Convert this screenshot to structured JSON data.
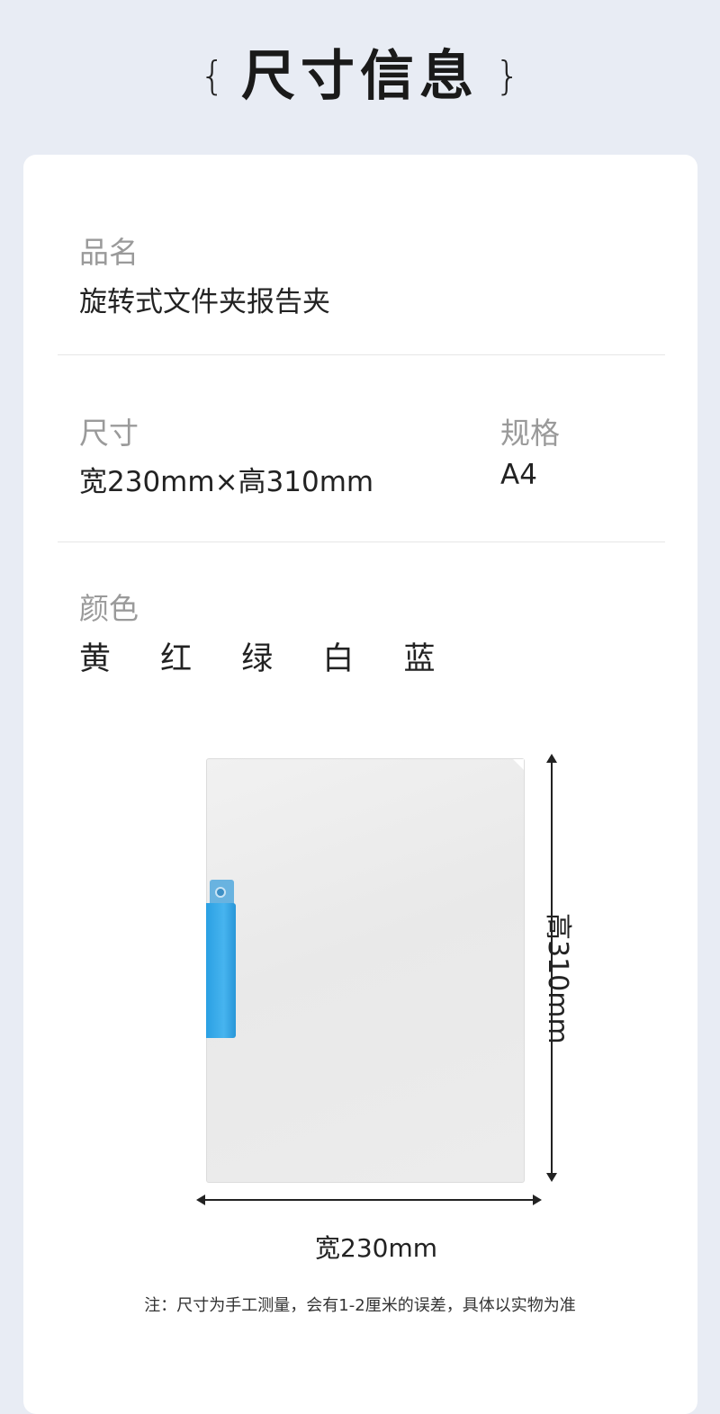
{
  "header": {
    "brace_left": "{",
    "title": "尺寸信息",
    "brace_right": "}"
  },
  "product": {
    "label": "品名",
    "value": "旋转式文件夹报告夹"
  },
  "size": {
    "label": "尺寸",
    "value": "宽230mm×高310mm"
  },
  "spec": {
    "label": "规格",
    "value": "A4"
  },
  "color": {
    "label": "颜色",
    "value": "黄 红 绿 白 蓝"
  },
  "diagram": {
    "height_label": "高310mm",
    "width_label": "宽230mm"
  },
  "note": "注：尺寸为手工测量，会有1-2厘米的误差，具体以实物为准"
}
